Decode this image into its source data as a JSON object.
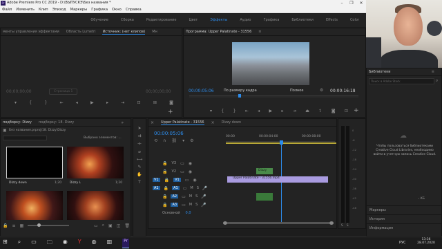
{
  "app": {
    "title": "Adobe Premiere Pro CC 2019 - D:\\ВЫПУСКЭ\\Без названия *",
    "icon_label": "Pr",
    "window_controls": [
      "–",
      "❐",
      "✕"
    ]
  },
  "menu": [
    "Файл",
    "Изменить",
    "Клип",
    "Эпизод",
    "Маркеры",
    "Графика",
    "Окно",
    "Справка"
  ],
  "workspaces": {
    "tabs": [
      "Обучение",
      "Сборка",
      "Редактирование",
      "Цвет",
      "Эффекты",
      "Аудио",
      "Графика",
      "Библиотеки",
      "Effects",
      "Color"
    ],
    "active": "Эффекты"
  },
  "source_panel": {
    "tabs": [
      "менты управления эффектами",
      "Область Lumetri",
      "Источник: (нет клипов)",
      "Мн"
    ],
    "timecode_left": "00;00;00;00",
    "timecode_right": "00;00;00;00",
    "page_label": "Страница 1"
  },
  "program_panel": {
    "title": "Программа: Upper Palatinate - 31556",
    "menu_icon": "≡",
    "timecode": "00:00:05:06",
    "fit_label": "По размеру кадра",
    "quality_label": "Полное",
    "duration": "00:00:16:18"
  },
  "project_panel": {
    "tabs": [
      "подборку: Dizzy",
      "подборку: 18. Dizzy"
    ],
    "path": "Без названия.prproj\\18. Dizzy\\Dizzy",
    "selected_label": "Выбрано элементов: ...",
    "items": [
      {
        "name": "Dizzy down",
        "duration": "1;20"
      },
      {
        "name": "Dizzy L",
        "duration": "1;20"
      },
      {
        "name": "",
        "duration": ""
      },
      {
        "name": "",
        "duration": ""
      }
    ]
  },
  "timeline": {
    "tabs": [
      "Upper Palatinate - 31556",
      "Dizzy down"
    ],
    "timecode": "00:00:05:06",
    "ruler": [
      "00:00",
      "00:00:04:00",
      "00:00:08:00"
    ],
    "tracks": {
      "video": [
        "V3",
        "V2",
        "V1"
      ],
      "audio": [
        "A1",
        "A2",
        "A3"
      ],
      "left_tags": [
        "V1",
        "A1"
      ],
      "master_label": "Основной",
      "master_value": "0,0"
    },
    "clips": {
      "v1": "Upper Palatinate - 31556.mp4",
      "v2": "Dizzy"
    }
  },
  "meters": {
    "labels": [
      "0",
      "-6",
      "-12",
      "-18",
      "-24",
      "-30",
      "-36",
      "-42",
      "-48",
      "-54"
    ],
    "bottom": [
      "S",
      "S"
    ]
  },
  "libraries": {
    "title": "Библиотеки",
    "menu_icon": "≡",
    "search_placeholder": "Поиск в Adobe Stock",
    "message": "Чтобы пользоваться библиотеками Creative Cloud Libraries, необходимо войти в учетную запись Creative Cloud.",
    "kb": "– КБ",
    "sections": [
      "Маркеры",
      "История",
      "Информация"
    ]
  },
  "taskbar": {
    "apps": [
      "⊞",
      "⌕",
      "▭",
      "🗀",
      "◉",
      "Y",
      "◍",
      "▥",
      "Pr"
    ],
    "lang": "РУС",
    "time": "13:36",
    "date": "28.07.2020"
  },
  "colors": {
    "accent": "#2d8ceb",
    "playhead": "#2d8ceb",
    "video_clip": "#a99be0",
    "green_clip": "#4a8a4a"
  }
}
